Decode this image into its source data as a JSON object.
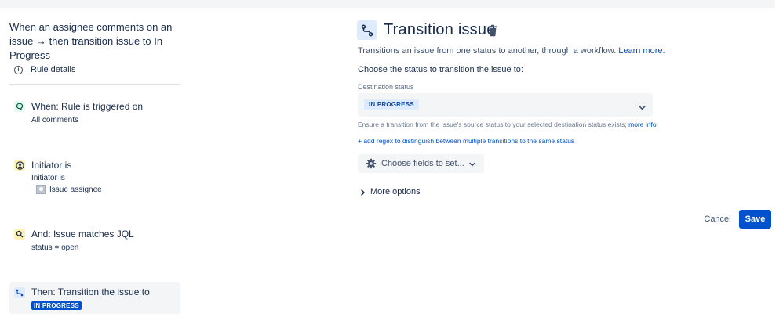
{
  "rule": {
    "title": "When an assignee comments on an issue → then transition issue to In Progress",
    "details_label": "Rule details"
  },
  "steps": {
    "trigger": {
      "title": "When: Rule is triggered on",
      "subtitle": "All comments",
      "icon": "comment-icon"
    },
    "initiator": {
      "title": "Initiator is",
      "subtitle": "Initiator is",
      "value": "Issue assignee",
      "icon": "user-circle-icon"
    },
    "jql": {
      "title": "And: Issue matches JQL",
      "subtitle": "status = open",
      "icon": "search-icon"
    },
    "action": {
      "title": "Then: Transition the issue to",
      "status": "IN PROGRESS",
      "icon": "transition-icon"
    }
  },
  "panel": {
    "heading": "Transition issue",
    "description": "Transitions an issue from one status to another, through a workflow.",
    "learn_more": "Learn more.",
    "choose_label": "Choose the status to transition the issue to:",
    "destination_label": "Destination status",
    "destination_value": "IN PROGRESS",
    "hint": "Ensure a transition from the issue's source status to your selected destination status exists;",
    "hint_link": "more info.",
    "add_regex": "+ add regex to distinguish between multiple transitions to the same status",
    "choose_fields": "Choose fields to set...",
    "more_options": "More options"
  },
  "actions": {
    "cancel": "Cancel",
    "save": "Save"
  },
  "colors": {
    "primary": "#0052cc",
    "lozenge_light_bg": "#deebff",
    "lozenge_light_text": "#0747a6",
    "trigger_icon_bg": "#e3fcef",
    "condition_icon_bg": "#fff0b3",
    "selected_step_bg": "#f4f5f7"
  }
}
